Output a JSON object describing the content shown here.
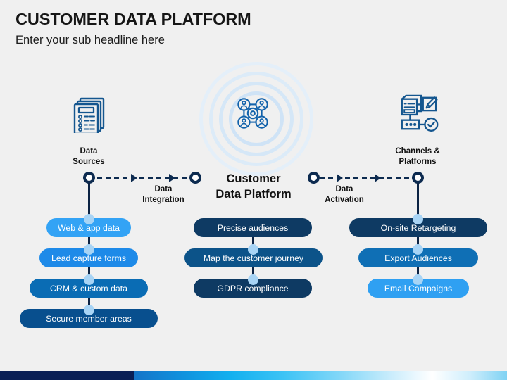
{
  "header": {
    "title": "CUSTOMER DATA PLATFORM",
    "subtitle": "Enter your sub headline here"
  },
  "columns": {
    "left": {
      "icon": "documents-stack-icon",
      "label": "Data\nSources",
      "items": [
        {
          "label": "Web & app data",
          "color": "#33a3f5"
        },
        {
          "label": "Lead capture forms",
          "color": "#1e8ae8"
        },
        {
          "label": "CRM & custom data",
          "color": "#0a6cb4"
        },
        {
          "label": "Secure member areas",
          "color": "#084f8e"
        }
      ]
    },
    "center": {
      "icon": "people-network-icon",
      "label": "Customer\nData Platform",
      "items": [
        {
          "label": "Precise audiences",
          "color": "#0e3a63"
        },
        {
          "label": "Map the customer journey",
          "color": "#0c5389"
        },
        {
          "label": "GDPR compliance",
          "color": "#0e3a63"
        }
      ]
    },
    "right": {
      "icon": "channels-platforms-icon",
      "label": "Channels &\nPlatforms",
      "items": [
        {
          "label": "On-site Retargeting",
          "color": "#0e3a63"
        },
        {
          "label": "Export Audiences",
          "color": "#0f6fb5"
        },
        {
          "label": "Email Campaigns",
          "color": "#2fa0f2"
        }
      ]
    }
  },
  "connectors": [
    {
      "label": "Data\nIntegration",
      "name": "data-integration"
    },
    {
      "label": "Data\nActivation",
      "name": "data-activation"
    }
  ],
  "colors": {
    "background": "#f0f0f0",
    "navy": "#0d2b50",
    "bar_navy": "#0a1f56",
    "accent_blue": "#1077c4",
    "node_light": "#a8d4f5",
    "ring_light": "#dbeafa"
  }
}
